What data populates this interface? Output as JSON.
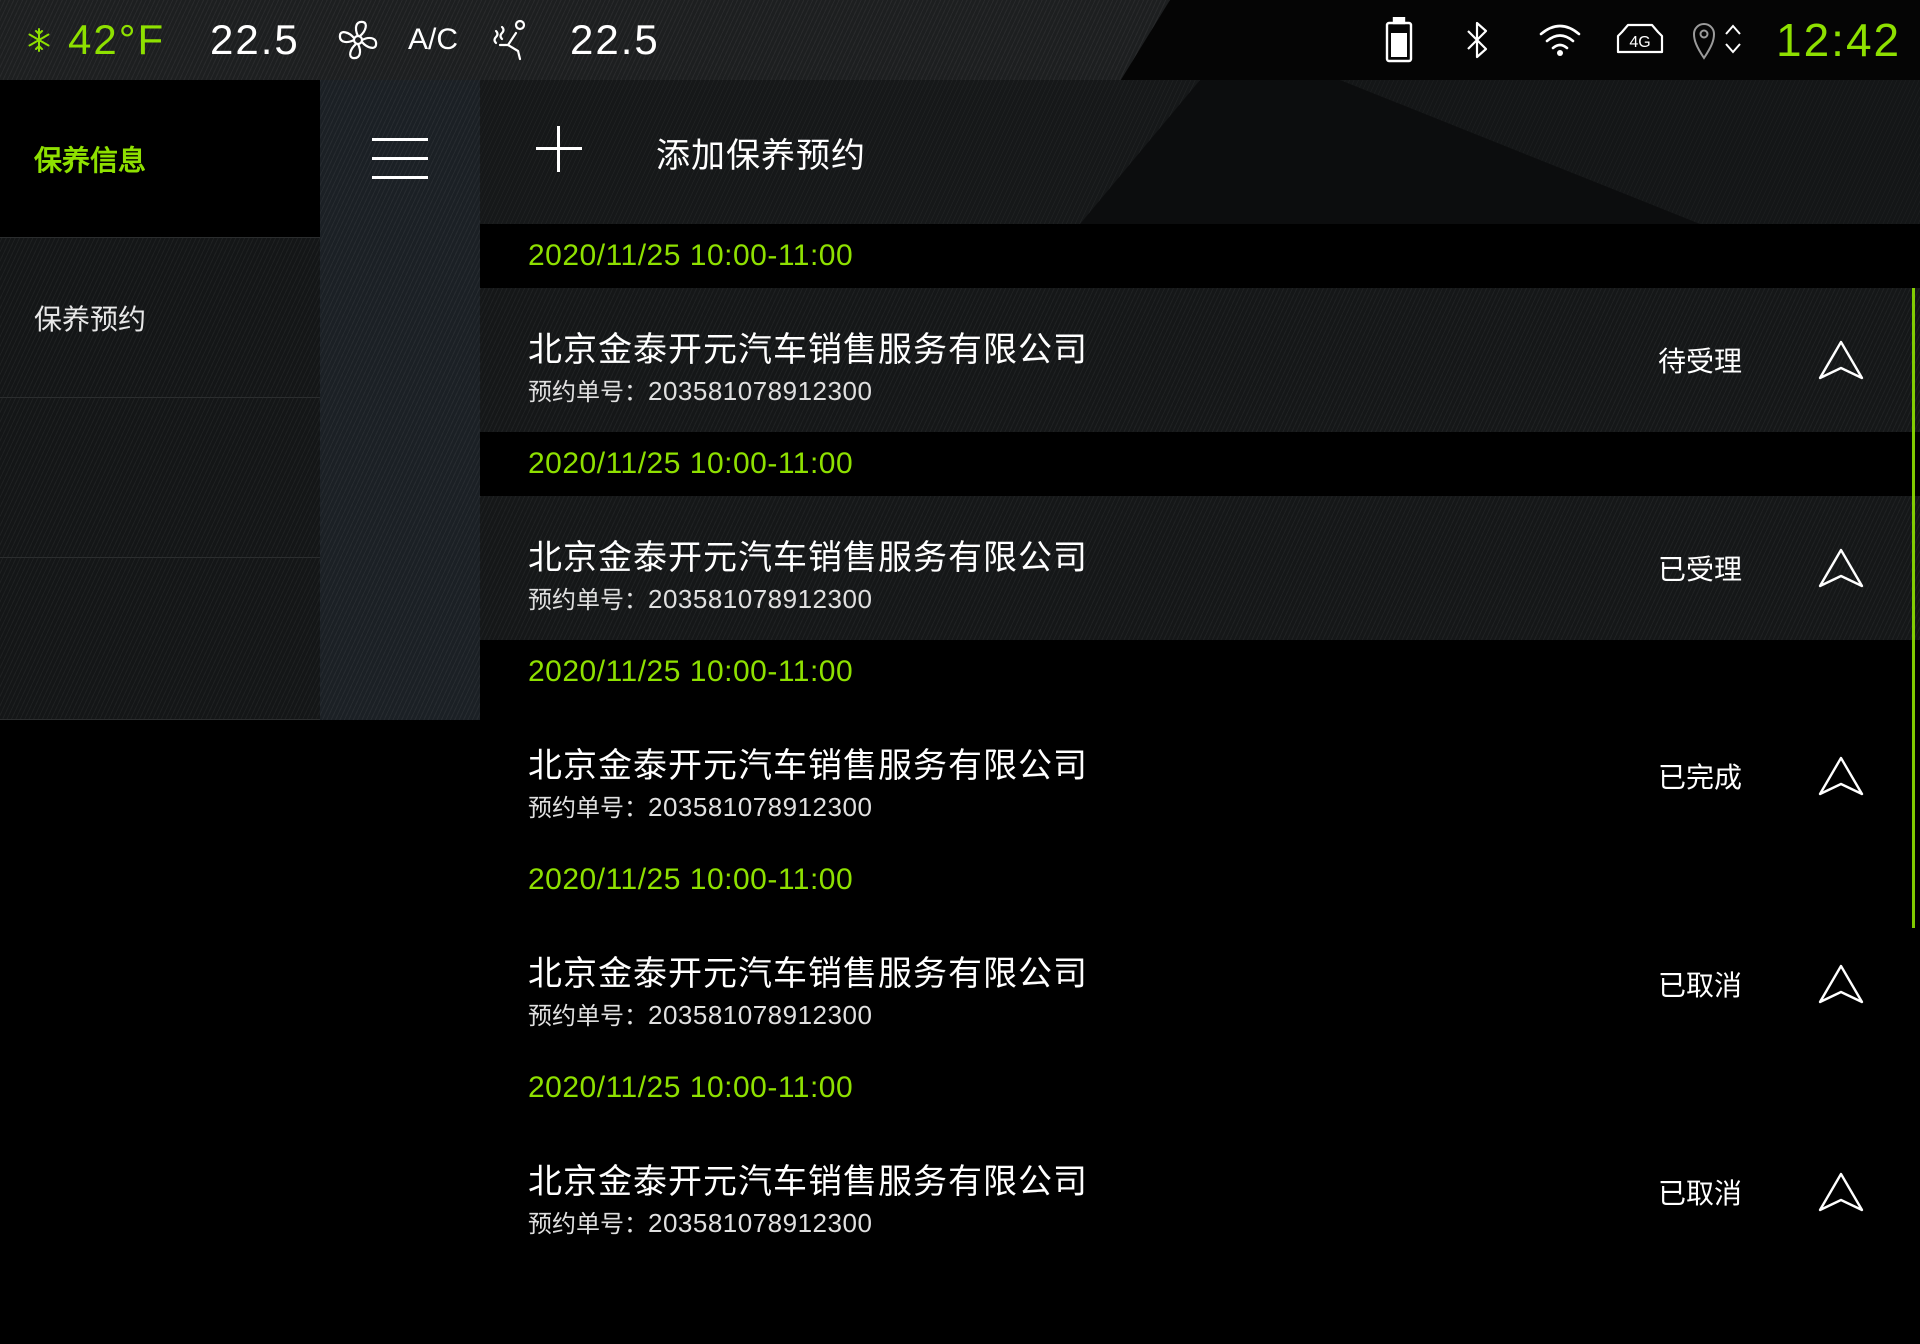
{
  "status_bar": {
    "outside_temp": "42°F",
    "left_temp": "22.5",
    "ac_label": "A/C",
    "right_temp": "22.5",
    "network": "4G",
    "time": "12:42",
    "accent_color": "#8ee000"
  },
  "left_menu": {
    "items": [
      {
        "label": "保养信息",
        "active": true
      },
      {
        "label": "保养预约",
        "active": false
      }
    ]
  },
  "header": {
    "add_label": "添加保养预约"
  },
  "list": {
    "order_prefix": "预约单号：",
    "entries": [
      {
        "date": "2020/11/25 10:00-11:00",
        "company": "北京金泰开元汽车销售服务有限公司",
        "order_no": "203581078912300",
        "status": "待受理"
      },
      {
        "date": "2020/11/25 10:00-11:00",
        "company": "北京金泰开元汽车销售服务有限公司",
        "order_no": "203581078912300",
        "status": "已受理"
      },
      {
        "date": "2020/11/25 10:00-11:00",
        "company": "北京金泰开元汽车销售服务有限公司",
        "order_no": "203581078912300",
        "status": "已完成"
      },
      {
        "date": "2020/11/25 10:00-11:00",
        "company": "北京金泰开元汽车销售服务有限公司",
        "order_no": "203581078912300",
        "status": "已取消"
      },
      {
        "date": "2020/11/25 10:00-11:00",
        "company": "北京金泰开元汽车销售服务有限公司",
        "order_no": "203581078912300",
        "status": "已取消"
      }
    ]
  }
}
